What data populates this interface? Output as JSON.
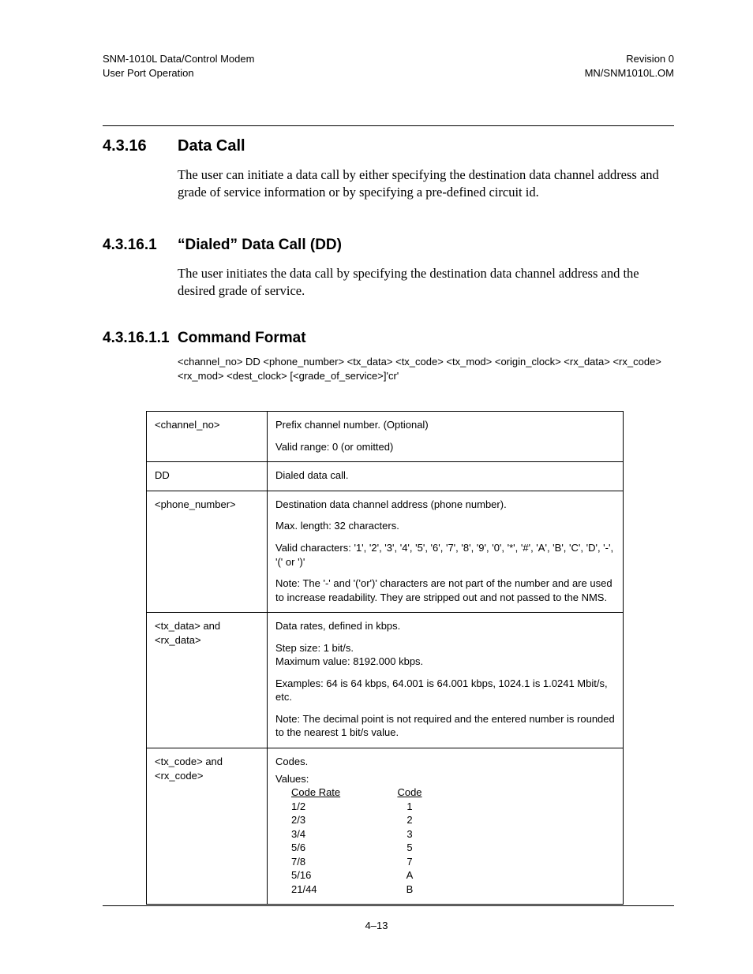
{
  "header": {
    "left1": "SNM-1010L Data/Control Modem",
    "left2": "User Port Operation",
    "right1": "Revision 0",
    "right2": "MN/SNM1010L.OM"
  },
  "s1": {
    "num": "4.3.16",
    "title": "Data Call",
    "body": "The user can initiate a data call by either specifying the destination data channel address and grade of service information or by specifying a pre-defined circuit id."
  },
  "s2": {
    "num": "4.3.16.1",
    "title": "“Dialed” Data Call (DD)",
    "body": "The user initiates the data call by specifying the destination data channel address and the desired grade of service."
  },
  "s3": {
    "num": "4.3.16.1.1",
    "title": "Command Format",
    "cmd": " <channel_no> DD <phone_number> <tx_data> <tx_code> <tx_mod> <origin_clock> <rx_data> <rx_code><rx_mod> <dest_clock> [<grade_of_service>]'cr'"
  },
  "table": {
    "r1": {
      "c1": "<channel_no>",
      "l1": "Prefix channel number. (Optional)",
      "l2": "Valid range: 0 (or omitted)"
    },
    "r2": {
      "c1": "DD",
      "l1": "Dialed data call."
    },
    "r3": {
      "c1": "<phone_number>",
      "l1": "Destination data channel address (phone number).",
      "l2": "Max. length: 32 characters.",
      "l3": "Valid characters:  '1', '2', '3', '4', '5', '6', '7', '8', '9', '0', '*', '#', 'A', 'B', 'C', 'D', '-', '(' or ')'",
      "l4": "Note: The '-' and '('or')' characters are not part of the number and are used to increase readability. They are stripped out and not passed to the NMS."
    },
    "r4": {
      "c1": "<tx_data> and <rx_data>",
      "l1": "Data rates, defined in kbps.",
      "l2a": "Step size: 1 bit/s.",
      "l2b": "Maximum value: 8192.000 kbps.",
      "l3": "Examples: 64 is 64 kbps, 64.001 is 64.001 kbps, 1024.1 is 1.0241 Mbit/s, etc.",
      "l4": "Note: The decimal point is not required and the entered number is rounded to the nearest 1 bit/s value."
    },
    "r5": {
      "c1": "<tx_code> and <rx_code>",
      "l1": "Codes.",
      "l2": "Values:",
      "h1": "Code Rate",
      "h2": "Code",
      "rows": [
        {
          "rate": "1/2",
          "code": "1"
        },
        {
          "rate": "2/3",
          "code": "2"
        },
        {
          "rate": "3/4",
          "code": "3"
        },
        {
          "rate": "5/6",
          "code": "5"
        },
        {
          "rate": "7/8",
          "code": "7"
        },
        {
          "rate": "5/16",
          "code": "A"
        },
        {
          "rate": "21/44",
          "code": "B"
        }
      ]
    }
  },
  "footer": {
    "page": "4–13"
  }
}
